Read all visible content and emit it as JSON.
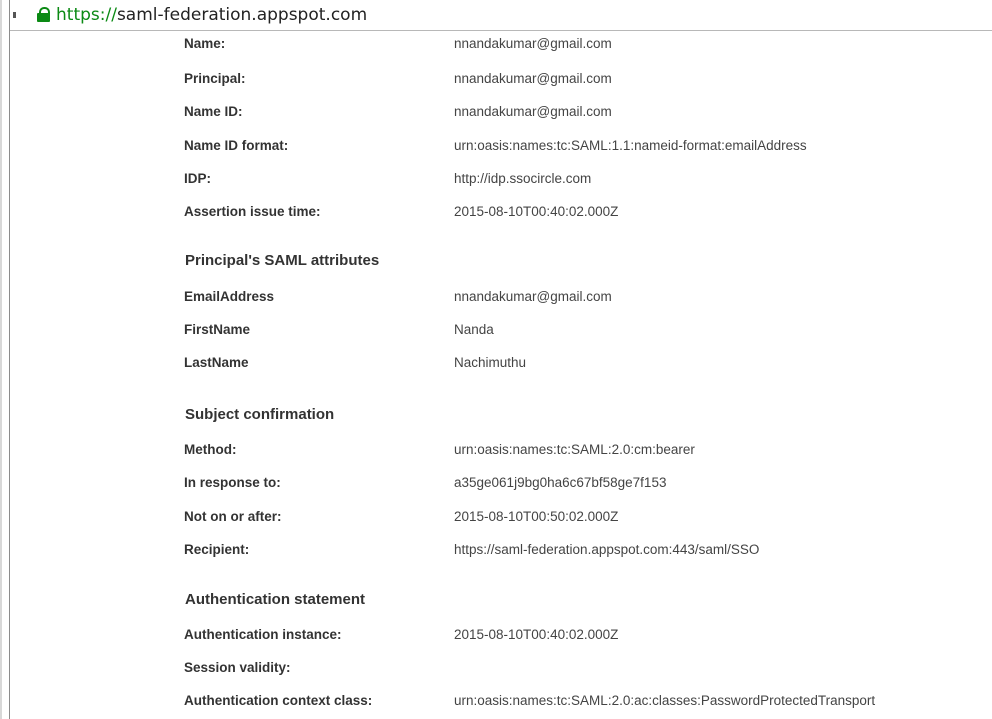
{
  "browser": {
    "url_scheme": "https://",
    "url_host": "saml-federation.appspot.com"
  },
  "assertion": {
    "name_label": "Name:",
    "name_value": "nnandakumar@gmail.com",
    "principal_label": "Principal:",
    "principal_value": "nnandakumar@gmail.com",
    "name_id_label": "Name ID:",
    "name_id_value": "nnandakumar@gmail.com",
    "name_id_format_label": "Name ID format:",
    "name_id_format_value": "urn:oasis:names:tc:SAML:1.1:nameid-format:emailAddress",
    "idp_label": "IDP:",
    "idp_value": "http://idp.ssocircle.com",
    "issue_time_label": "Assertion issue time:",
    "issue_time_value": "2015-08-10T00:40:02.000Z"
  },
  "attributes": {
    "heading": "Principal's SAML attributes",
    "email_label": "EmailAddress",
    "email_value": "nnandakumar@gmail.com",
    "first_label": "FirstName",
    "first_value": "Nanda",
    "last_label": "LastName",
    "last_value": "Nachimuthu"
  },
  "subject": {
    "heading": "Subject confirmation",
    "method_label": "Method:",
    "method_value": "urn:oasis:names:tc:SAML:2.0:cm:bearer",
    "in_response_label": "In response to:",
    "in_response_value": "a35ge061j9bg0ha6c67bf58ge7f153",
    "not_after_label": "Not on or after:",
    "not_after_value": "2015-08-10T00:50:02.000Z",
    "recipient_label": "Recipient:",
    "recipient_value": "https://saml-federation.appspot.com:443/saml/SSO"
  },
  "authn": {
    "heading": "Authentication statement",
    "instance_label": "Authentication instance:",
    "instance_value": "2015-08-10T00:40:02.000Z",
    "session_label": "Session validity:",
    "session_value": "",
    "context_label": "Authentication context class:",
    "context_value": "urn:oasis:names:tc:SAML:2.0:ac:classes:PasswordProtectedTransport"
  }
}
